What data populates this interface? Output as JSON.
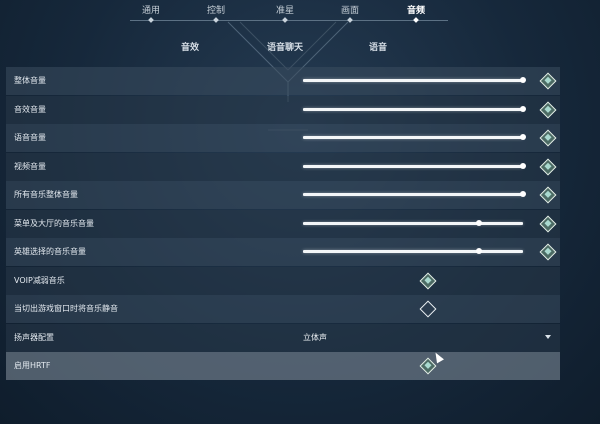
{
  "top_tabs": [
    {
      "label": "通用",
      "active": false
    },
    {
      "label": "控制",
      "active": false
    },
    {
      "label": "准星",
      "active": false
    },
    {
      "label": "画面",
      "active": false
    },
    {
      "label": "音频",
      "active": true
    }
  ],
  "sub_tabs": [
    {
      "label": "音效"
    },
    {
      "label": "语音聊天"
    },
    {
      "label": "语音"
    }
  ],
  "settings": [
    {
      "label": "整体音量",
      "type": "slider",
      "value": 1.0,
      "checkbox": "on"
    },
    {
      "label": "音效音量",
      "type": "slider",
      "value": 1.0,
      "checkbox": "on"
    },
    {
      "label": "语音音量",
      "type": "slider",
      "value": 1.0,
      "checkbox": "on"
    },
    {
      "label": "视频音量",
      "type": "slider",
      "value": 1.0,
      "checkbox": "on"
    },
    {
      "label": "所有音乐整体音量",
      "type": "slider",
      "value": 1.0,
      "checkbox": "on"
    },
    {
      "label": "菜单及大厅的音乐音量",
      "type": "slider",
      "value": 0.8,
      "checkbox": "on"
    },
    {
      "label": "英雄选择的音乐音量",
      "type": "slider",
      "value": 0.8,
      "checkbox": "on"
    },
    {
      "label": "VOIP减弱音乐",
      "type": "toggle",
      "checkbox": "on"
    },
    {
      "label": "当切出游戏窗口时将音乐静音",
      "type": "toggle",
      "checkbox": "off"
    },
    {
      "label": "扬声器配置",
      "type": "dropdown",
      "value": "立体声"
    },
    {
      "label": "启用HRTF",
      "type": "toggle",
      "checkbox": "on"
    }
  ],
  "colors": {
    "background": "#1a2d41",
    "row": "#3a4c5f",
    "row_highlight": "#78848f",
    "accent": "#a9d9cf"
  }
}
